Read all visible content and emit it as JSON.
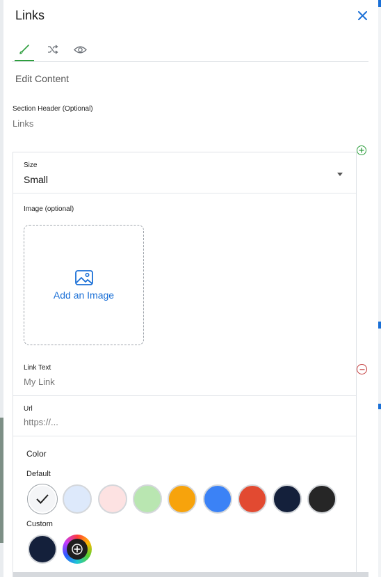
{
  "panel": {
    "title": "Links",
    "tabs": [
      {
        "name": "edit",
        "icon": "brush-icon"
      },
      {
        "name": "logic",
        "icon": "shuffle-icon"
      },
      {
        "name": "visibility",
        "icon": "eye-icon"
      }
    ],
    "section_title": "Edit Content"
  },
  "section_header": {
    "label": "Section Header (Optional)",
    "placeholder": "Links"
  },
  "size": {
    "label": "Size",
    "value": "Small"
  },
  "image": {
    "label": "Image (optional)",
    "add_label": "Add an Image"
  },
  "link_text": {
    "label": "Link Text",
    "placeholder": "My Link"
  },
  "url": {
    "label": "Url",
    "placeholder": "https://..."
  },
  "color": {
    "label": "Color",
    "default_label": "Default",
    "custom_label": "Custom",
    "default_swatches": [
      "#f4f5f7",
      "#dde9fb",
      "#fde2e2",
      "#b9e6b1",
      "#f7a30c",
      "#3b82f6",
      "#e24a31",
      "#14203b",
      "#262626"
    ],
    "selected_index": 0,
    "custom_swatches": [
      "#14203b"
    ]
  },
  "colors": {
    "accent_green": "#2e9e3e",
    "accent_blue": "#1a6fd6",
    "remove_red": "#c23a3a"
  }
}
